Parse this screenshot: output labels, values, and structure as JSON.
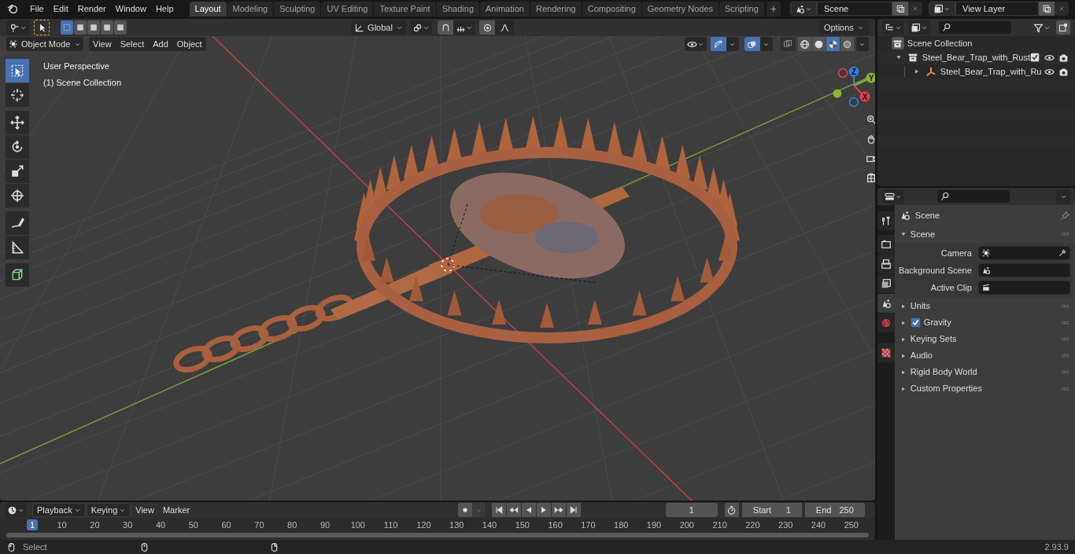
{
  "menu_bar": {
    "items": [
      "File",
      "Edit",
      "Render",
      "Window",
      "Help"
    ]
  },
  "workspace_tabs": [
    {
      "label": "Layout",
      "selected": true
    },
    {
      "label": "Modeling",
      "selected": false
    },
    {
      "label": "Sculpting",
      "selected": false
    },
    {
      "label": "UV Editing",
      "selected": false
    },
    {
      "label": "Texture Paint",
      "selected": false
    },
    {
      "label": "Shading",
      "selected": false
    },
    {
      "label": "Animation",
      "selected": false
    },
    {
      "label": "Rendering",
      "selected": false
    },
    {
      "label": "Compositing",
      "selected": false
    },
    {
      "label": "Geometry Nodes",
      "selected": false
    },
    {
      "label": "Scripting",
      "selected": false
    }
  ],
  "add_workspace": "+",
  "scene_selector": {
    "value": "Scene"
  },
  "view_layer_selector": {
    "value": "View Layer"
  },
  "viewport": {
    "select_modes": [
      {
        "selected": true
      },
      {
        "selected": false
      },
      {
        "selected": false
      },
      {
        "selected": false
      },
      {
        "selected": false
      }
    ],
    "transform_orientation": "Global",
    "options": "Options",
    "mode": "Object Mode",
    "menus": [
      "View",
      "Select",
      "Add",
      "Object"
    ],
    "shading_modes": [
      {
        "kind": "wireframe",
        "selected": false
      },
      {
        "kind": "solid",
        "selected": false
      },
      {
        "kind": "material",
        "selected": true
      },
      {
        "kind": "rendered",
        "selected": false
      }
    ],
    "overlay_text": [
      "User Perspective",
      "(1) Scene Collection"
    ],
    "tools": [
      {
        "kind": "select",
        "selected": true
      },
      {
        "kind": "cursor",
        "selected": false
      },
      {
        "kind": "move",
        "selected": false
      },
      {
        "kind": "rotate",
        "selected": false
      },
      {
        "kind": "scale",
        "selected": false
      },
      {
        "kind": "transform",
        "selected": false
      },
      {
        "kind": "annotate",
        "selected": false
      },
      {
        "kind": "measure",
        "selected": false
      },
      {
        "kind": "add-cube",
        "selected": false
      }
    ],
    "gizmo_axes": [
      {
        "label": "Z",
        "color": "#2f83e3"
      },
      {
        "label": "Y",
        "color": "#8bb535"
      },
      {
        "label": "X",
        "color": "#e93d53"
      }
    ]
  },
  "outliner": {
    "root": "Scene Collection",
    "items": [
      {
        "label": "Steel_Bear_Trap_with_Rust",
        "kind": "collection",
        "expanded": true,
        "checked": true,
        "children": [
          {
            "label": "Steel_Bear_Trap_with_Ru",
            "kind": "object",
            "expanded": false
          }
        ]
      }
    ]
  },
  "properties": {
    "tabs": [
      {
        "kind": "tool",
        "selected": false
      },
      {
        "kind": "render",
        "selected": false
      },
      {
        "kind": "output",
        "selected": false
      },
      {
        "kind": "view-layer",
        "selected": false
      },
      {
        "kind": "scene",
        "selected": true
      },
      {
        "kind": "world",
        "selected": false
      },
      {
        "kind": "texture",
        "selected": false
      }
    ],
    "context": "Scene",
    "section": {
      "label": "Scene",
      "expanded": true,
      "fields": [
        {
          "label": "Camera",
          "kind": "camera"
        },
        {
          "label": "Background Scene",
          "kind": "scene"
        },
        {
          "label": "Active Clip",
          "kind": "clip"
        }
      ]
    },
    "panels": [
      {
        "label": "Units",
        "kind": "plain",
        "expanded": false
      },
      {
        "label": "Gravity",
        "kind": "checkbox",
        "checked": true,
        "expanded": false
      },
      {
        "label": "Keying Sets",
        "kind": "plain",
        "expanded": false
      },
      {
        "label": "Audio",
        "kind": "plain",
        "expanded": false
      },
      {
        "label": "Rigid Body World",
        "kind": "plain",
        "expanded": false
      },
      {
        "label": "Custom Properties",
        "kind": "plain",
        "expanded": false
      }
    ]
  },
  "timeline": {
    "menus": [
      "Playback",
      "Keying",
      "View",
      "Marker"
    ],
    "current_frame": "1",
    "start_label": "Start",
    "start": "1",
    "end_label": "End",
    "end": "250",
    "ruler": [
      "1",
      "10",
      "20",
      "30",
      "40",
      "50",
      "60",
      "70",
      "80",
      "90",
      "100",
      "110",
      "120",
      "130",
      "140",
      "150",
      "160",
      "170",
      "180",
      "190",
      "200",
      "210",
      "220",
      "230",
      "240",
      "250"
    ]
  },
  "status_bar": {
    "hint": "Select",
    "version": "2.93.9"
  }
}
